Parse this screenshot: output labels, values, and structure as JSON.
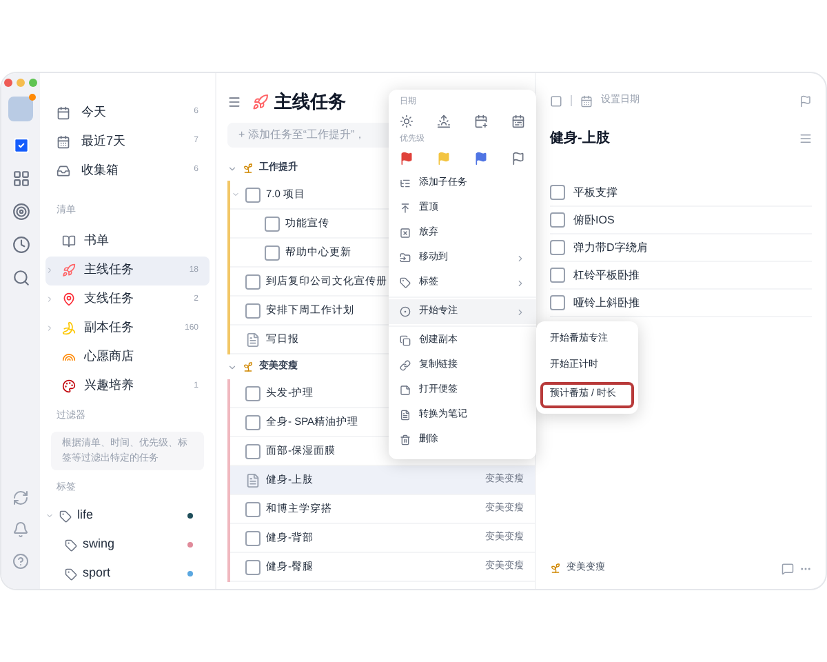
{
  "sidebar": {
    "smart_lists": [
      {
        "name": "今天",
        "count": "6"
      },
      {
        "name": "最近7天",
        "count": "7"
      },
      {
        "name": "收集箱",
        "count": "6"
      }
    ],
    "lists_label": "清单",
    "lists": [
      {
        "name": "书单",
        "expandable": false,
        "selected": false
      },
      {
        "name": "主线任务",
        "count": "18",
        "expandable": true,
        "selected": true
      },
      {
        "name": "支线任务",
        "count": "2",
        "expandable": true,
        "selected": false
      },
      {
        "name": "副本任务",
        "count": "160",
        "expandable": true,
        "selected": false
      },
      {
        "name": "心愿商店",
        "expandable": false,
        "selected": false
      },
      {
        "name": "兴趣培养",
        "count": "1",
        "expandable": false,
        "selected": false
      }
    ],
    "filters_label": "过滤器",
    "filters_hint": "根据清单、时间、优先级、标签等过滤出特定的任务",
    "tags_label": "标签",
    "tags": [
      {
        "name": "life",
        "color": "#1f4e5a",
        "expanded": true,
        "children": [
          {
            "name": "swing",
            "color": "#e08a9a"
          },
          {
            "name": "sport",
            "color": "#5aa7e0"
          }
        ]
      }
    ]
  },
  "task_list": {
    "title": "主线任务",
    "add_placeholder": "+ 添加任务至“工作提升”，",
    "groups": [
      {
        "name": "工作提升",
        "expanded": true,
        "color": "#f2c766",
        "tasks": [
          {
            "title": "7.0 项目",
            "kind": "task",
            "expanded": true,
            "selected": false,
            "children": [
              {
                "title": "功能宣传",
                "kind": "task",
                "selected": false
              },
              {
                "title": "帮助中心更新",
                "kind": "task",
                "selected": false
              }
            ]
          },
          {
            "title": "到店复印公司文化宣传册",
            "kind": "task",
            "selected": false
          },
          {
            "title": "安排下周工作计划",
            "kind": "task",
            "selected": false
          },
          {
            "title": "写日报",
            "kind": "note",
            "selected": false
          }
        ]
      },
      {
        "name": "变美变瘦",
        "expanded": true,
        "color": "#f0b8bf",
        "tasks": [
          {
            "title": "头发-护理",
            "kind": "task",
            "selected": false
          },
          {
            "title": "全身- SPA精油护理",
            "kind": "task",
            "selected": false
          },
          {
            "title": "面部-保湿面膜",
            "kind": "task",
            "selected": false
          },
          {
            "title": "健身-上肢",
            "kind": "note",
            "tag": "变美变瘦",
            "selected": true
          },
          {
            "title": "和博主学穿搭",
            "kind": "task",
            "tag": "变美变瘦",
            "selected": false
          },
          {
            "title": "健身-背部",
            "kind": "task",
            "tag": "变美变瘦",
            "selected": false
          },
          {
            "title": "健身-臀腿",
            "kind": "task",
            "tag": "变美变瘦",
            "selected": false
          }
        ]
      }
    ]
  },
  "context_menu": {
    "date_label": "日期",
    "priority_label": "优先级",
    "priorities": [
      {
        "color": "#e0413a",
        "filled": true
      },
      {
        "color": "#f3c441",
        "filled": true
      },
      {
        "color": "#4f74e3",
        "filled": true
      },
      {
        "color": "#6b7280",
        "filled": false
      }
    ],
    "items": [
      {
        "label": "添加子任务",
        "submenu": false,
        "selected": false
      },
      {
        "label": "置顶",
        "submenu": false,
        "selected": false
      },
      {
        "label": "放弃",
        "submenu": false,
        "selected": false
      },
      {
        "label": "移动到",
        "submenu": true,
        "selected": false
      },
      {
        "label": "标签",
        "submenu": true,
        "selected": false
      },
      {
        "label": "开始专注",
        "submenu": true,
        "selected": true
      },
      {
        "label": "创建副本",
        "submenu": false,
        "selected": false
      },
      {
        "label": "复制链接",
        "submenu": false,
        "selected": false
      },
      {
        "label": "打开便签",
        "submenu": false,
        "selected": false
      },
      {
        "label": "转换为笔记",
        "submenu": false,
        "selected": false
      },
      {
        "label": "删除",
        "submenu": false,
        "selected": false
      }
    ],
    "submenu": [
      {
        "label": "开始番茄专注",
        "highlighted": false
      },
      {
        "label": "开始正计时",
        "highlighted": false
      },
      {
        "label": "预计番茄 / 时长",
        "highlighted": true
      }
    ]
  },
  "detail": {
    "date_button": "设置日期",
    "title": "健身-上肢",
    "checklist": [
      {
        "text": "平板支撑",
        "checked": false
      },
      {
        "text": "俯卧IOS",
        "checked": false
      },
      {
        "text": "弹力带D字绕肩",
        "checked": false
      },
      {
        "text": "杠铃平板卧推",
        "checked": false
      },
      {
        "text": "哑铃上斜卧推",
        "checked": false
      }
    ],
    "list_tag": "变美变瘦"
  }
}
